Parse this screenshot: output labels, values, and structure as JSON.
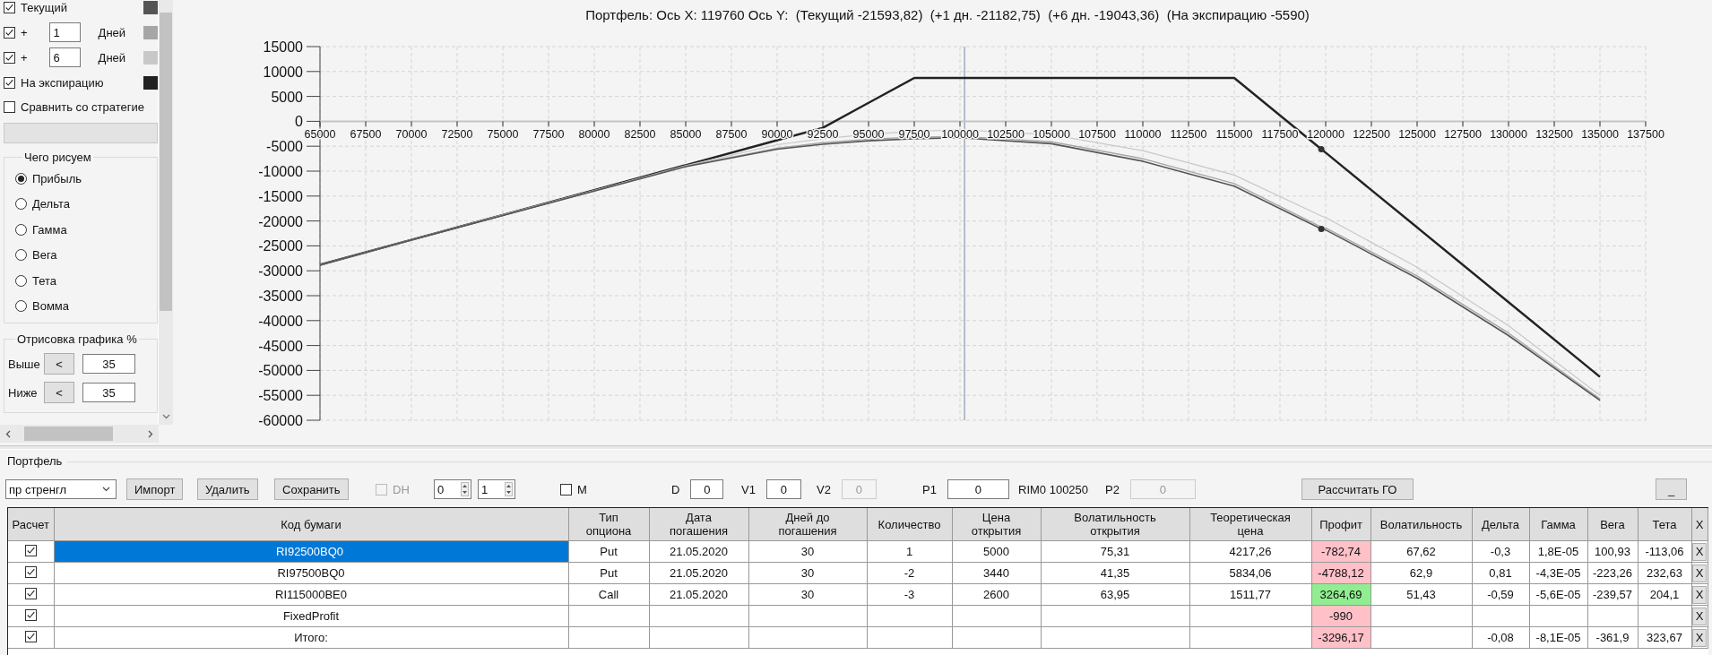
{
  "display": {
    "series": [
      {
        "kind": "label",
        "label": "Текущий",
        "checked": true,
        "color": "#555555"
      },
      {
        "kind": "offset",
        "prefix": "+",
        "days": "1",
        "unit": "Дней",
        "checked": true,
        "color": "#a6a6a6"
      },
      {
        "kind": "offset",
        "prefix": "+",
        "days": "6",
        "unit": "Дней",
        "checked": true,
        "color": "#c8c8c8"
      },
      {
        "kind": "label",
        "label": "На экспирацию",
        "checked": true,
        "color": "#222222"
      }
    ],
    "compare": {
      "label": "Сравнить со стратегие",
      "checked": false
    },
    "draw_group": {
      "title": "Чего рисуем",
      "options": [
        {
          "label": "Прибыль",
          "selected": true
        },
        {
          "label": "Дельта",
          "selected": false
        },
        {
          "label": "Гамма",
          "selected": false
        },
        {
          "label": "Вега",
          "selected": false
        },
        {
          "label": "Тета",
          "selected": false
        },
        {
          "label": "Вомма",
          "selected": false
        }
      ]
    },
    "range_group": {
      "title": "Отрисовка графика %",
      "rows": [
        {
          "label": "Выше",
          "button": "<",
          "value": "35"
        },
        {
          "label": "Ниже",
          "button": "<",
          "value": "35"
        }
      ]
    }
  },
  "chart": {
    "chart_data": {
      "type": "line",
      "title": "Портфель: Ось X: 119760 Ось Y:  (Текущий -21593,82)  (+1 дн. -21182,75)  (+6 дн. -19043,36)  (На экспирацию -5590)",
      "x": [
        65000,
        70000,
        75000,
        80000,
        85000,
        90000,
        92500,
        95000,
        97500,
        100000,
        105000,
        110000,
        115000,
        119760,
        120000,
        125000,
        130000,
        135000
      ],
      "series": [
        {
          "type": "line",
          "color": "#555555",
          "values": [
            -28800,
            -23800,
            -18900,
            -14000,
            -9100,
            -5600,
            -4600,
            -3900,
            -3500,
            -3300,
            -4500,
            -8000,
            -13000,
            -21600,
            -21800,
            -31500,
            -43000,
            -56000
          ]
        },
        {
          "type": "line",
          "color": "#a6a6a6",
          "values": [
            -28800,
            -23800,
            -18800,
            -13900,
            -9000,
            -5400,
            -4300,
            -3600,
            -3200,
            -3000,
            -4100,
            -7500,
            -12500,
            -21200,
            -21400,
            -31000,
            -42500,
            -55700
          ]
        },
        {
          "type": "line",
          "color": "#c8c8c8",
          "values": [
            -28800,
            -23800,
            -18800,
            -13900,
            -8900,
            -4700,
            -3500,
            -2600,
            -2000,
            -1700,
            -2700,
            -5900,
            -10800,
            -19000,
            -19300,
            -29300,
            -41000,
            -55000
          ]
        },
        {
          "type": "line",
          "color": "#222222",
          "values": [
            -28800,
            -23800,
            -18800,
            -13800,
            -8800,
            -3800,
            -1300,
            3700,
            8700,
            8700,
            8700,
            8700,
            8700,
            -5600,
            -6300,
            -21300,
            -36300,
            -51300
          ]
        },
        {
          "type": "scatter",
          "color": "#333333",
          "values": [
            null,
            null,
            null,
            null,
            null,
            null,
            null,
            null,
            null,
            null,
            null,
            null,
            null,
            -5600,
            null,
            null,
            null,
            null
          ]
        },
        {
          "type": "scatter",
          "color": "#333333",
          "values": [
            null,
            null,
            null,
            null,
            null,
            null,
            null,
            null,
            null,
            null,
            null,
            null,
            null,
            -21600,
            null,
            null,
            null,
            null
          ]
        }
      ],
      "xlim": [
        65000,
        137500
      ],
      "ylim": [
        -60000,
        15000
      ],
      "grid": true,
      "xticks": [
        65000,
        67500,
        70000,
        72500,
        75000,
        77500,
        80000,
        82500,
        85000,
        87500,
        90000,
        92500,
        95000,
        97500,
        100000,
        102500,
        105000,
        107500,
        110000,
        112500,
        115000,
        117500,
        120000,
        122500,
        125000,
        127500,
        130000,
        132500,
        135000,
        137500
      ],
      "yticks": [
        15000,
        10000,
        5000,
        0,
        -5000,
        -10000,
        -15000,
        -20000,
        -25000,
        -30000,
        -35000,
        -40000,
        -45000,
        -50000,
        -55000,
        -60000
      ],
      "ref_lines": [
        {
          "axis": "x",
          "value": 100250
        }
      ]
    }
  },
  "portfolio": {
    "title": "Портфель",
    "strategy": "пр стренгл",
    "buttons": [
      "Импорт",
      "Удалить",
      "Сохранить"
    ],
    "dh": {
      "label": "DH",
      "checked": false,
      "disabled": true
    },
    "spinners": [
      "0",
      "1"
    ],
    "m": {
      "label": "M",
      "checked": false
    },
    "params": [
      {
        "label": "D",
        "value": "0",
        "disabled": false
      },
      {
        "label": "V1",
        "value": "0",
        "disabled": false
      },
      {
        "label": "V2",
        "value": "0",
        "disabled": true
      },
      {
        "label": "P1",
        "value": "0",
        "disabled": false
      }
    ],
    "underlying": "RIM0 100250",
    "p2": {
      "label": "P2",
      "value": "0",
      "disabled": true
    },
    "calc_button": "Рассчитать ГО",
    "minimize_button": "_"
  },
  "table": {
    "columns": [
      "Расчет",
      "Код бумаги",
      "Тип\nопциона",
      "Дата\nпогашения",
      "Дней до\nпогашения",
      "Количество",
      "Цена\nоткрытия",
      "Волатильность\nоткрытия",
      "Теоретическая\nцена",
      "Профит",
      "Волатильность",
      "Дельта",
      "Гамма",
      "Вега",
      "Тета",
      "X"
    ],
    "rows": [
      {
        "selected": true,
        "cells": [
          {
            "kind": "checkbox",
            "checked": true
          },
          "RI92500BQ0",
          "Put",
          "21.05.2020",
          "30",
          "1",
          "5000",
          "75,31",
          "4217,26",
          {
            "kind": "colored",
            "text": "-782,74",
            "color": "#ffc0c8"
          },
          "67,62",
          "-0,3",
          "1,8E-05",
          "100,93",
          "-113,06",
          {
            "kind": "button",
            "text": "X"
          }
        ]
      },
      {
        "selected": false,
        "cells": [
          {
            "kind": "checkbox",
            "checked": true
          },
          "RI97500BQ0",
          "Put",
          "21.05.2020",
          "30",
          "-2",
          "3440",
          "41,35",
          "5834,06",
          {
            "kind": "colored",
            "text": "-4788,12",
            "color": "#ffc0c8"
          },
          "62,9",
          "0,81",
          "-4,3E-05",
          "-223,26",
          "232,63",
          {
            "kind": "button",
            "text": "X"
          }
        ]
      },
      {
        "selected": false,
        "cells": [
          {
            "kind": "checkbox",
            "checked": true
          },
          "RI115000BE0",
          "Call",
          "21.05.2020",
          "30",
          "-3",
          "2600",
          "63,95",
          "1511,77",
          {
            "kind": "colored",
            "text": "3264,69",
            "color": "#90ee90"
          },
          "51,43",
          "-0,59",
          "-5,6E-05",
          "-239,57",
          "204,1",
          {
            "kind": "button",
            "text": "X"
          }
        ]
      },
      {
        "selected": false,
        "cells": [
          {
            "kind": "checkbox",
            "checked": true
          },
          "FixedProfit",
          "",
          "",
          "",
          "",
          "",
          "",
          "",
          {
            "kind": "colored",
            "text": "-990",
            "color": "#ffc0c8"
          },
          "",
          "",
          "",
          "",
          "",
          {
            "kind": "button",
            "text": "X"
          }
        ]
      },
      {
        "selected": false,
        "cells": [
          {
            "kind": "checkbox",
            "checked": true
          },
          "Итого:",
          "",
          "",
          "",
          "",
          "",
          "",
          "",
          {
            "kind": "colored",
            "text": "-3296,17",
            "color": "#ffc0c8"
          },
          "",
          "-0,08",
          "-8,1E-05",
          "-361,9",
          "323,67",
          {
            "kind": "button",
            "text": "X"
          }
        ]
      }
    ]
  }
}
